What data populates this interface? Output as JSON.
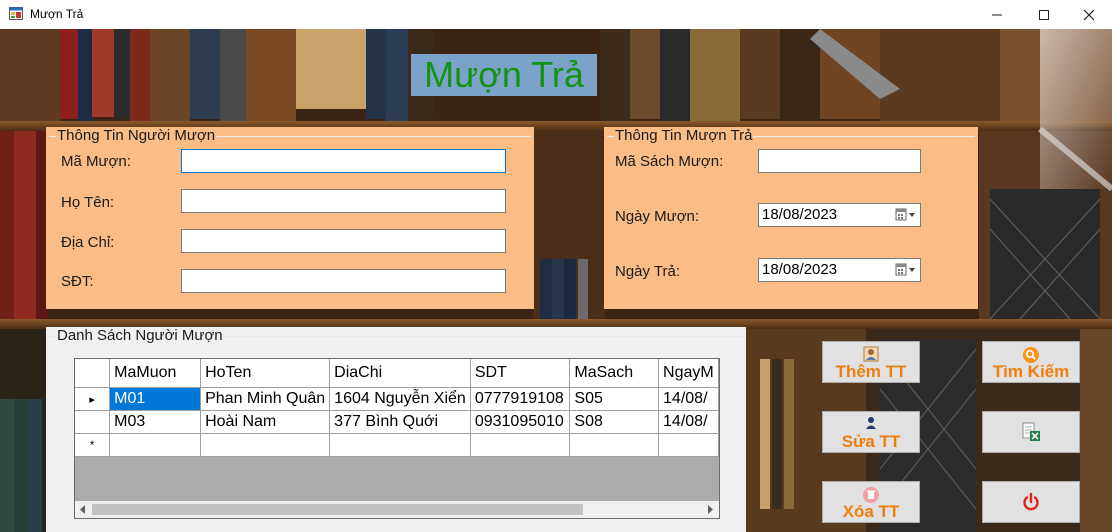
{
  "window": {
    "title": "Mượn Trả"
  },
  "page_title": "Mượn Trả",
  "borrower_group": {
    "title": "Thông Tin Người Mượn",
    "fields": [
      {
        "label": "Mã Mượn:",
        "value": ""
      },
      {
        "label": "Họ Tên:",
        "value": ""
      },
      {
        "label": "Địa Chỉ:",
        "value": ""
      },
      {
        "label": "SĐT:",
        "value": ""
      }
    ]
  },
  "loan_group": {
    "title": "Thông Tin Mượn Trả",
    "book_label": "Mã Sách Mượn:",
    "book_value": "",
    "borrow_label": "Ngày Mượn:",
    "borrow_date": "18/08/2023",
    "return_label": "Ngày Trả:",
    "return_date": "18/08/2023"
  },
  "list_group": {
    "title": "Danh Sách Người Mượn",
    "columns": [
      "MaMuon",
      "HoTen",
      "DiaChi",
      "SDT",
      "MaSach",
      "NgayM"
    ],
    "rows": [
      [
        "M01",
        "Phan Minh Quân",
        "1604 Nguyễn Xiển",
        "0777919108",
        "S05",
        "14/08/"
      ],
      [
        "M03",
        "Hoài Nam",
        "377 Bình Quới",
        "0931095010",
        "S08",
        "14/08/"
      ]
    ],
    "current_row_marker": "▸",
    "new_row_marker": "*"
  },
  "buttons": {
    "add": "Thêm TT",
    "search": "Tìm Kiếm",
    "edit": "Sửa TT",
    "delete": "Xóa TT"
  },
  "colors": {
    "group_bg": "#fbbd85",
    "title_bg": "#7ba3c9",
    "title_text": "#139313",
    "button_text": "#f07d0c",
    "selection": "#0078d7"
  }
}
